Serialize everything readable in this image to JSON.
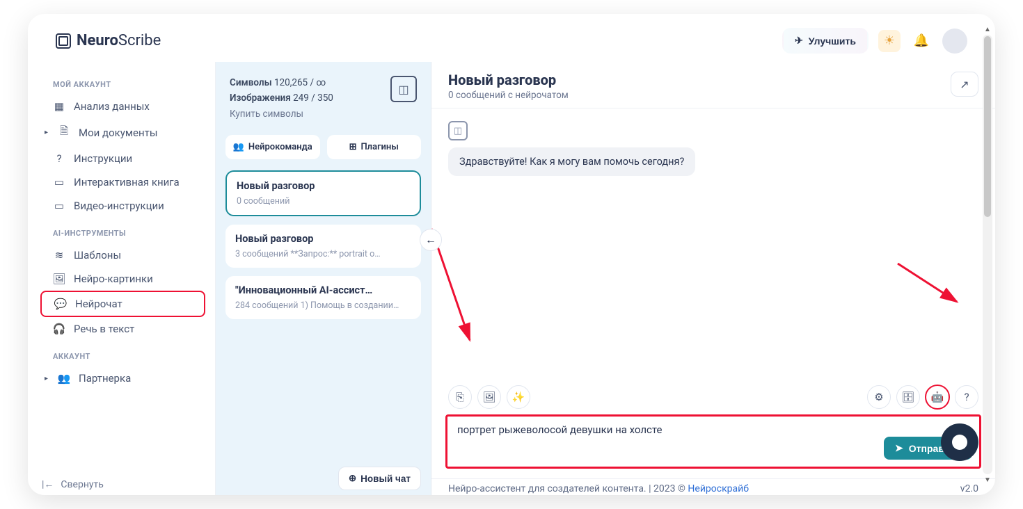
{
  "brand": {
    "logo_strong": "Neuro",
    "logo_light": "Scribe"
  },
  "header": {
    "upgrade": "Улучшить"
  },
  "sidebar": {
    "section1": "МОЙ АККАУНТ",
    "items1": [
      {
        "icon": "grid",
        "label": "Анализ данных"
      },
      {
        "icon": "doc",
        "label": "Мои документы",
        "expand": true
      },
      {
        "icon": "help",
        "label": "Инструкции"
      },
      {
        "icon": "book",
        "label": "Интерактивная книга"
      },
      {
        "icon": "video",
        "label": "Видео-инструкции"
      }
    ],
    "section2": "AI-ИНСТРУМЕНТЫ",
    "items2": [
      {
        "icon": "layers",
        "label": "Шаблоны"
      },
      {
        "icon": "image",
        "label": "Нейро-картинки"
      },
      {
        "icon": "chat",
        "label": "Нейрочат",
        "hl": true
      },
      {
        "icon": "head",
        "label": "Речь в текст"
      }
    ],
    "section3": "АККАУНТ",
    "items3": [
      {
        "icon": "partner",
        "label": "Партнерка",
        "expand": true
      }
    ],
    "collapse": "Свернуть"
  },
  "mid": {
    "symbols_label": "Символы",
    "symbols_val": "120,265 / ∞",
    "images_label": "Изображения",
    "images_val": "249 / 350",
    "buy": "Купить символы",
    "pill_team": "Нейрокоманда",
    "pill_plugins": "Плагины",
    "convs": [
      {
        "title": "Новый разговор",
        "sub": "0 сообщений",
        "active": true
      },
      {
        "title": "Новый разговор",
        "sub": "3 сообщений    **Запрос:** portrait о…"
      },
      {
        "title": "\"Инновационный AI-ассист…",
        "sub": "284 сообщений 1) Помощь в создании…"
      }
    ],
    "new_chat": "Новый чат"
  },
  "chat": {
    "title": "Новый разговор",
    "sub": "0 сообщений с нейрочатом",
    "greeting": "Здравствуйте! Как я могу вам помочь сегодня?",
    "input": "портрет рыжеволосой девушки на холсте",
    "send": "Отправить"
  },
  "footer": {
    "text_a": "Нейро-ассистент для создателей контента.  | 2023 © ",
    "link": "Нейроскрайб",
    "version": "v2.0"
  }
}
